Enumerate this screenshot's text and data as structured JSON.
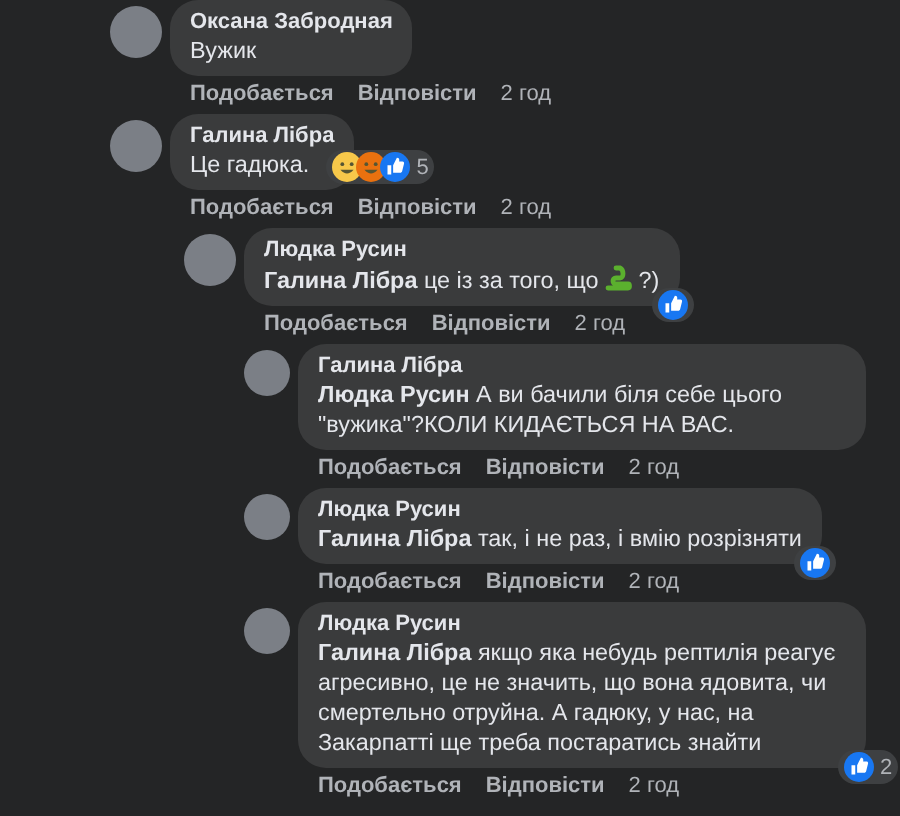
{
  "comments": [
    {
      "author": "Оксана Забродная",
      "segments": [
        {
          "kind": "text",
          "text": "Вужик"
        }
      ],
      "actions": [
        "Подобається",
        "Відповісти",
        "2 год"
      ]
    },
    {
      "author": "Галина Лібра",
      "segments": [
        {
          "kind": "text",
          "text": "Це гадюка."
        }
      ],
      "reactions": [
        {
          "kind": "haha"
        },
        {
          "kind": "angry"
        },
        {
          "kind": "like"
        }
      ],
      "reaction_count": "5",
      "actions": [
        "Подобається",
        "Відповісти",
        "2 год"
      ],
      "children": [
        {
          "author": "Людка Русин",
          "segments": [
            {
              "kind": "text",
              "text": "**Галина Лібра** це із за того, що"
            },
            {
              "kind": "emoji"
            },
            {
              "kind": "text",
              "text": "?)"
            }
          ],
          "reactions": [
            {
              "kind": "like"
            }
          ],
          "actions": [
            "Подобається",
            "Відповісти",
            "2 год"
          ],
          "children": [
            {
              "author": "Галина Лібра",
              "segments": [
                {
                  "kind": "text",
                  "text": "**Людка Русин** А ви бачили біля себе цього \"вужика\"?КОЛИ КИДАЄТЬСЯ НА ВАС."
                }
              ],
              "actions": [
                "Подобається",
                "Відповісти",
                "2 год"
              ]
            },
            {
              "author": "Людка Русин",
              "segments": [
                {
                  "kind": "text",
                  "text": "**Галина Лібра** так, і не раз, і вмію розрізняти"
                }
              ],
              "reactions": [
                {
                  "kind": "like"
                }
              ],
              "actions": [
                "Подобається",
                "Відповісти",
                "2 год"
              ]
            },
            {
              "author": "Людка Русин",
              "segments": [
                {
                  "kind": "text",
                  "text": "**Галина Лібра** якщо яка небудь рептилія реагує агресивно, це не значить, що вона ядовита, чи смертельно отруйна. А гадюку, у нас, на Закарпатті ще треба постаратись знайти"
                }
              ],
              "reactions": [
                {
                  "kind": "like"
                }
              ],
              "reaction_count": "2",
              "actions": [
                "Подобається",
                "Відповісти",
                "2 год"
              ]
            }
          ]
        }
      ]
    }
  ]
}
